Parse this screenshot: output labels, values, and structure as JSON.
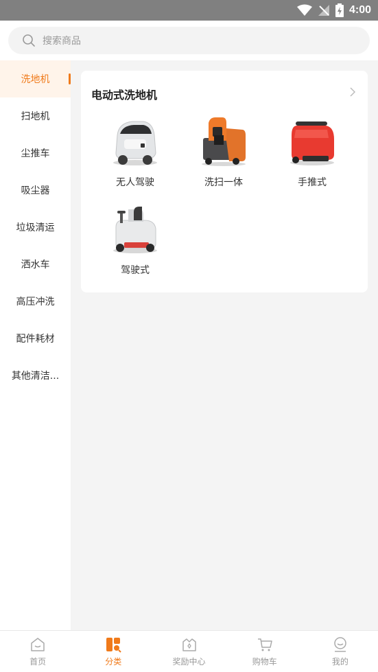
{
  "status_bar": {
    "time": "4:00",
    "icons": [
      "wifi-icon",
      "no-signal-icon",
      "battery-icon"
    ]
  },
  "search": {
    "placeholder": "搜索商品",
    "icon": "search-icon"
  },
  "sidebar": {
    "items": [
      {
        "label": "洗地机",
        "active": true
      },
      {
        "label": "扫地机",
        "active": false
      },
      {
        "label": "尘推车",
        "active": false
      },
      {
        "label": "吸尘器",
        "active": false
      },
      {
        "label": "垃圾清运",
        "active": false
      },
      {
        "label": "洒水车",
        "active": false
      },
      {
        "label": "高压冲洗",
        "active": false
      },
      {
        "label": "配件耗材",
        "active": false
      },
      {
        "label": "其他清洁...",
        "active": false
      }
    ]
  },
  "category": {
    "title": "电动式洗地机",
    "products": [
      {
        "label": "无人驾驶",
        "image": "autonomous-scrubber-image"
      },
      {
        "label": "洗扫一体",
        "image": "sweeper-scrubber-image"
      },
      {
        "label": "手推式",
        "image": "walk-behind-scrubber-image"
      },
      {
        "label": "驾驶式",
        "image": "ride-on-scrubber-image"
      }
    ]
  },
  "tabbar": {
    "items": [
      {
        "label": "首页",
        "icon": "home-icon",
        "active": false
      },
      {
        "label": "分类",
        "icon": "category-icon",
        "active": true
      },
      {
        "label": "奖励中心",
        "icon": "reward-icon",
        "active": false
      },
      {
        "label": "购物车",
        "icon": "cart-icon",
        "active": false
      },
      {
        "label": "我的",
        "icon": "profile-icon",
        "active": false
      }
    ]
  },
  "colors": {
    "accent": "#f07a1a",
    "status_bar": "#808080",
    "background": "#f4f4f4"
  }
}
